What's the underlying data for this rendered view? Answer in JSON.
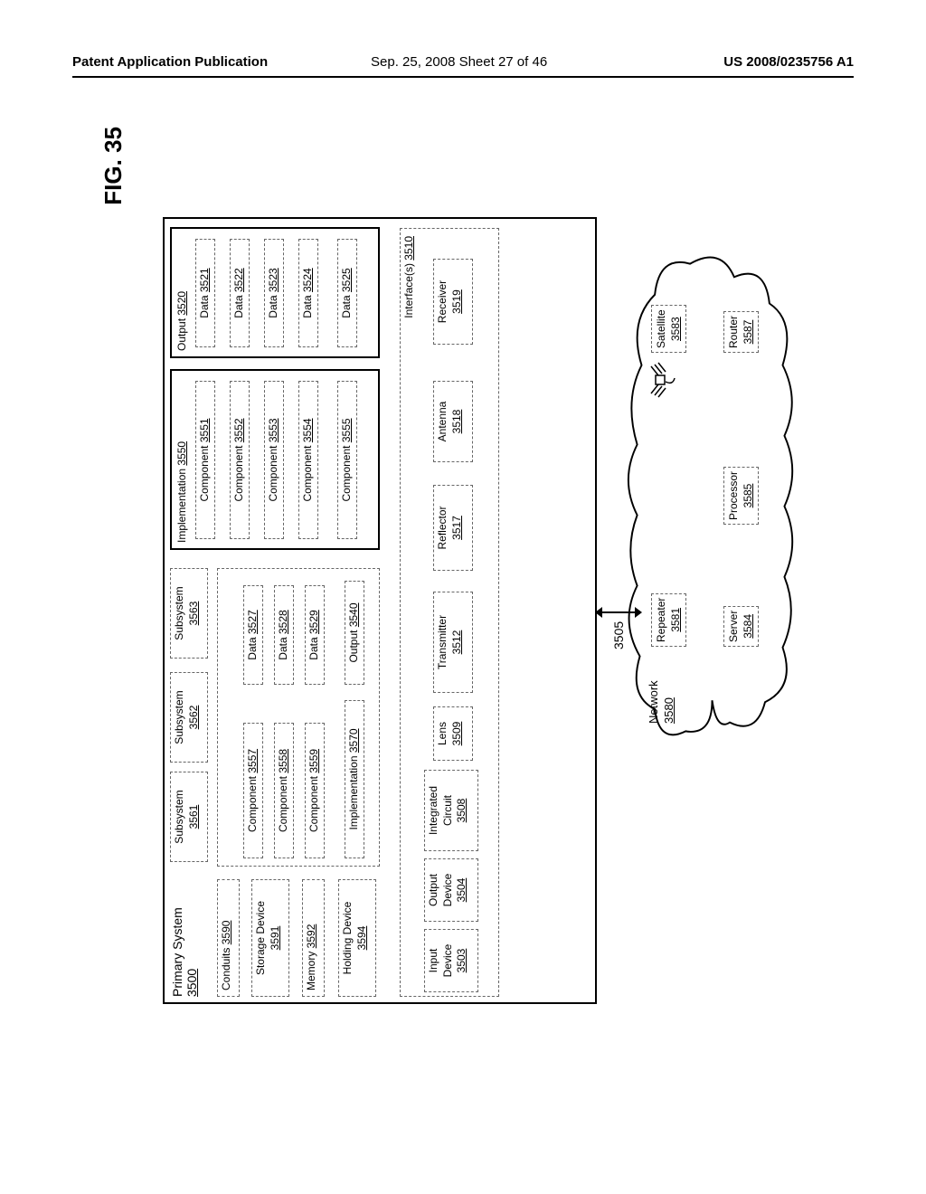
{
  "header": {
    "left": "Patent Application Publication",
    "mid": "Sep. 25, 2008  Sheet 27 of 46",
    "right": "US 2008/0235756 A1"
  },
  "figure_label": "FIG. 35",
  "arrow_label": "3505",
  "primary_system": {
    "title": "Primary System",
    "id": "3500"
  },
  "subsystems": {
    "s1": {
      "label": "Subsystem",
      "id": "3561"
    },
    "s2": {
      "label": "Subsystem",
      "id": "3562"
    },
    "s3": {
      "label": "Subsystem",
      "id": "3563"
    }
  },
  "left_col": {
    "conduits": {
      "label": "Conduits",
      "id": "3590"
    },
    "storage": {
      "label": "Storage Device",
      "id": "3591"
    },
    "memory": {
      "label": "Memory",
      "id": "3592"
    },
    "holding": {
      "label": "Holding Device",
      "id": "3594"
    }
  },
  "mid_comp": {
    "c1": {
      "label": "Component",
      "id": "3557"
    },
    "c2": {
      "label": "Component",
      "id": "3558"
    },
    "c3": {
      "label": "Component",
      "id": "3559"
    },
    "impl": {
      "label": "Implementation",
      "id": "3570"
    }
  },
  "mid_data": {
    "d1": {
      "label": "Data",
      "id": "3527"
    },
    "d2": {
      "label": "Data",
      "id": "3528"
    },
    "d3": {
      "label": "Data",
      "id": "3529"
    },
    "output": {
      "label": "Output",
      "id": "3540"
    }
  },
  "implementation": {
    "title": "Implementation",
    "id": "3550",
    "c1": {
      "label": "Component",
      "id": "3551"
    },
    "c2": {
      "label": "Component",
      "id": "3552"
    },
    "c3": {
      "label": "Component",
      "id": "3553"
    },
    "c4": {
      "label": "Component",
      "id": "3554"
    },
    "c5": {
      "label": "Component",
      "id": "3555"
    }
  },
  "output": {
    "title": "Output",
    "id": "3520",
    "d1": {
      "label": "Data",
      "id": "3521"
    },
    "d2": {
      "label": "Data",
      "id": "3522"
    },
    "d3": {
      "label": "Data",
      "id": "3523"
    },
    "d4": {
      "label": "Data",
      "id": "3524"
    },
    "d5": {
      "label": "Data",
      "id": "3525"
    }
  },
  "interfaces": {
    "title": "Interface(s)",
    "id": "3510",
    "input_dev": {
      "label": "Input Device",
      "id": "3503"
    },
    "output_dev": {
      "label": "Output Device",
      "id": "3504"
    },
    "ic": {
      "label": "Integrated Circuit",
      "id": "3508"
    },
    "lens": {
      "label": "Lens",
      "id": "3509"
    },
    "transmitter": {
      "label": "Transmitter",
      "id": "3512"
    },
    "reflector": {
      "label": "Reflector",
      "id": "3517"
    },
    "antenna": {
      "label": "Antenna",
      "id": "3518"
    },
    "receiver": {
      "label": "Receiver",
      "id": "3519"
    }
  },
  "network": {
    "title": "Network",
    "id": "3580",
    "repeater": {
      "label": "Repeater",
      "id": "3581"
    },
    "satellite": {
      "label": "Satellite",
      "id": "3583"
    },
    "server": {
      "label": "Server",
      "id": "3584"
    },
    "processor": {
      "label": "Processor",
      "id": "3585"
    },
    "router": {
      "label": "Router",
      "id": "3587"
    }
  }
}
